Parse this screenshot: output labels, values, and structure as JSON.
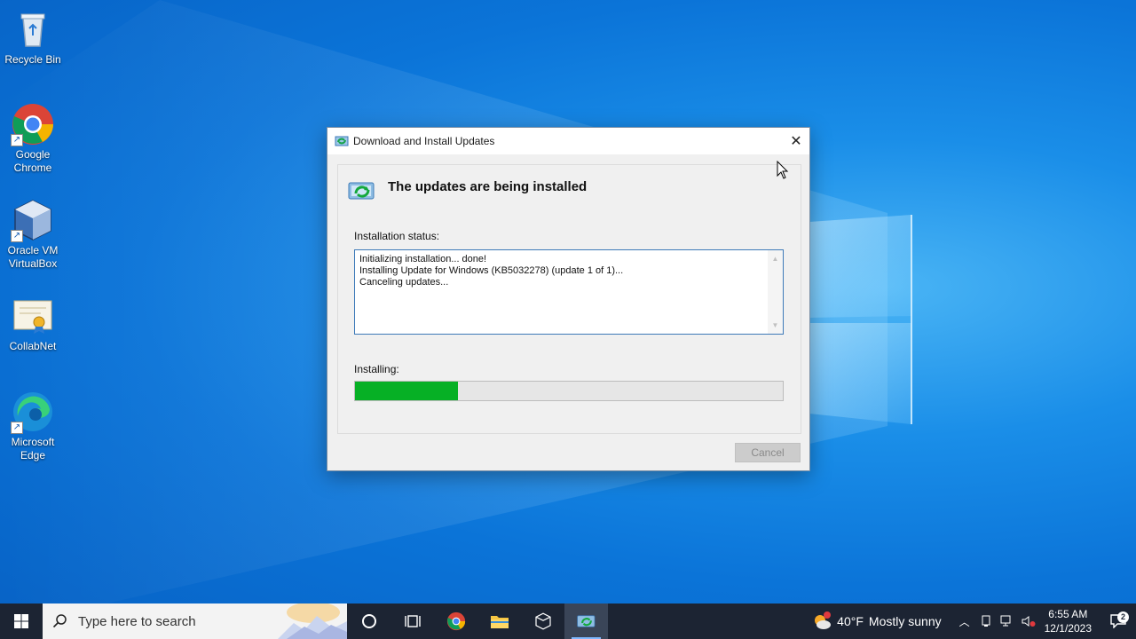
{
  "desktop": {
    "icons": [
      {
        "label": "Recycle Bin",
        "icon": "recycle-bin-icon"
      },
      {
        "label": "Google Chrome",
        "icon": "chrome-icon"
      },
      {
        "label": "Oracle VM VirtualBox",
        "icon": "virtualbox-icon"
      },
      {
        "label": "CollabNet",
        "icon": "certificate-icon"
      },
      {
        "label": "Microsoft Edge",
        "icon": "edge-icon"
      }
    ]
  },
  "dialog": {
    "title": "Download and Install Updates",
    "heading": "The updates are being installed",
    "status_label": "Installation status:",
    "status_lines": [
      "Initializing installation... done!",
      "Installing Update for Windows (KB5032278) (update 1 of 1)...",
      "Canceling updates..."
    ],
    "progress_label": "Installing:",
    "progress_fraction": 0.24,
    "cancel_label": "Cancel",
    "progress_color": "#06b025"
  },
  "taskbar": {
    "search_placeholder": "Type here to search",
    "weather_temp": "40°F",
    "weather_text": "Mostly sunny",
    "time": "6:55 AM",
    "date": "12/1/2023",
    "notification_count": "2"
  }
}
